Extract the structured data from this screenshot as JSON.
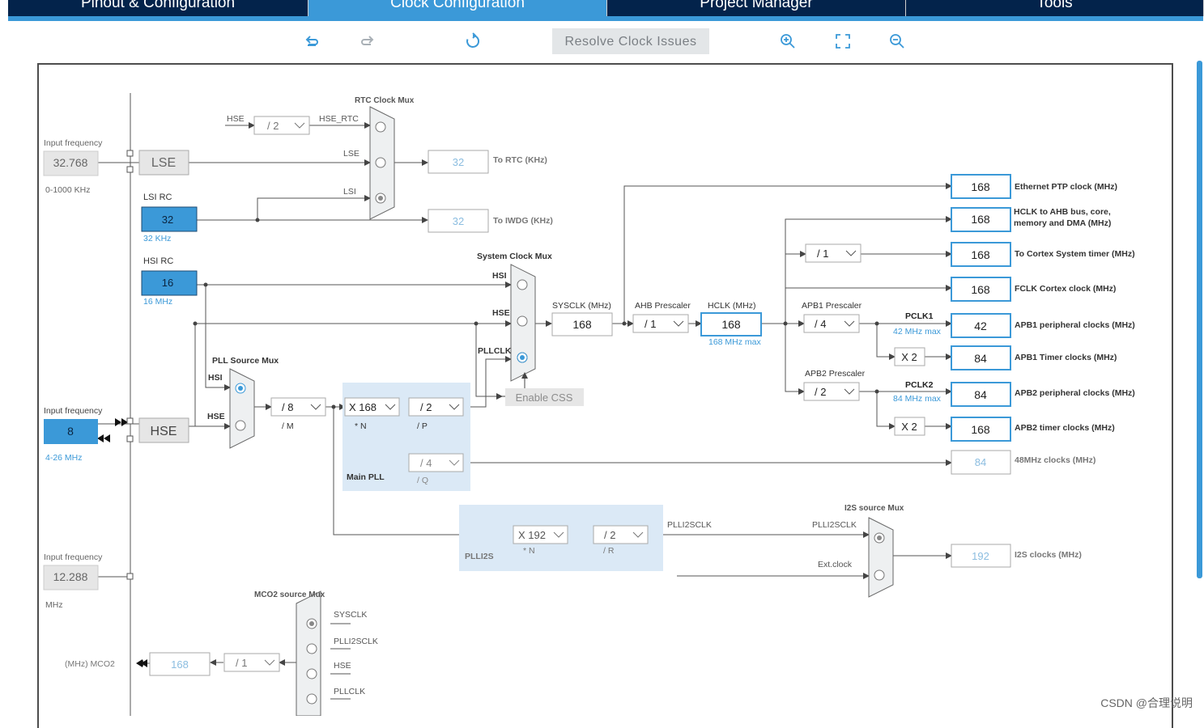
{
  "tabs": [
    {
      "label": "Pinout & Configuration"
    },
    {
      "label": "Clock Configuration"
    },
    {
      "label": "Project Manager"
    },
    {
      "label": "Tools"
    }
  ],
  "toolbar": {
    "resolve_label": "Resolve Clock Issues"
  },
  "icons": [
    "undo-icon",
    "redo-icon",
    "refresh-icon",
    "zoom-in-icon",
    "fit-screen-icon",
    "zoom-out-icon"
  ],
  "colors": {
    "tab_bg": "#03234b",
    "accent": "#3b99d8",
    "selected_box": "#3b99d8",
    "highlight_box": "#dbe9f6"
  },
  "inputs": {
    "lse": {
      "caption": "Input frequency",
      "value": "32.768",
      "range": "0-1000 KHz",
      "label": "LSE"
    },
    "hse": {
      "caption": "Input frequency",
      "value": "8",
      "range": "4-26 MHz",
      "label": "HSE"
    },
    "i2s_ext": {
      "caption": "Input frequency",
      "value": "12.288",
      "range": "MHz"
    }
  },
  "lsi": {
    "title": "LSI RC",
    "value": "32",
    "note": "32 KHz"
  },
  "hsi": {
    "title": "HSI RC",
    "value": "16",
    "note": "16 MHz"
  },
  "rtc": {
    "mux_title": "RTC Clock Mux",
    "hse_label": "HSE",
    "div": "/ 2",
    "hse_rtc_label": "HSE_RTC",
    "lse_label": "LSE",
    "lsi_label": "LSI",
    "out_value": "32",
    "out_label": "To RTC (KHz)",
    "iwdg_value": "32",
    "iwdg_label": "To IWDG (KHz)"
  },
  "sys": {
    "mux_title": "System Clock Mux",
    "hsi": "HSI",
    "hse": "HSE",
    "pllclk": "PLLCLK",
    "sysclk_label": "SYSCLK (MHz)",
    "sysclk": "168",
    "ahb_label": "AHB Prescaler",
    "ahb": "/ 1",
    "hclk_label": "HCLK (MHz)",
    "hclk": "168",
    "hclk_max": "168 MHz max",
    "enable_css": "Enable CSS"
  },
  "pll": {
    "mux_title": "PLL Source Mux",
    "hsi": "HSI",
    "hse": "HSE",
    "m": "/ 8",
    "m_label": "/ M",
    "n": "X 168",
    "n_label": "* N",
    "p": "/ 2",
    "p_label": "/ P",
    "q": "/ 4",
    "q_label": "/ Q",
    "title": "Main PLL"
  },
  "plli2s": {
    "title": "PLLI2S",
    "n": "X 192",
    "n_label": "* N",
    "r": "/ 2",
    "r_label": "/ R",
    "out_label": "PLLI2SCLK"
  },
  "i2s": {
    "mux_title": "I2S source Mux",
    "plli2sclk": "PLLI2SCLK",
    "ext": "Ext.clock",
    "value": "192",
    "label": "I2S clocks (MHz)"
  },
  "apb1": {
    "label": "APB1 Prescaler",
    "div": "/ 4",
    "pclk": "PCLK1",
    "max": "42 MHz max",
    "x2": "X 2"
  },
  "apb2": {
    "label": "APB2 Prescaler",
    "div": "/ 2",
    "pclk": "PCLK2",
    "max": "84 MHz max",
    "x2": "X 2"
  },
  "cortex_div": "/ 1",
  "outputs": [
    {
      "value": "168",
      "label": "Ethernet PTP clock (MHz)"
    },
    {
      "value": "168",
      "label": "HCLK to AHB bus, core, memory and DMA (MHz)"
    },
    {
      "value": "168",
      "label": "To Cortex System timer (MHz)"
    },
    {
      "value": "168",
      "label": "FCLK Cortex clock (MHz)"
    },
    {
      "value": "42",
      "label": "APB1 peripheral clocks (MHz)"
    },
    {
      "value": "84",
      "label": "APB1 Timer clocks (MHz)"
    },
    {
      "value": "84",
      "label": "APB2 peripheral clocks (MHz)"
    },
    {
      "value": "168",
      "label": "APB2 timer clocks (MHz)"
    },
    {
      "value": "84",
      "label": "48MHz clocks (MHz)"
    }
  ],
  "mco2": {
    "mux_title": "MCO2 source Mux",
    "sysclk": "SYSCLK",
    "plli2sclk": "PLLI2SCLK",
    "hse": "HSE",
    "pllclk": "PLLCLK",
    "div": "/ 1",
    "value": "168",
    "label": "(MHz) MCO2"
  },
  "watermark": "CSDN @合理说明"
}
